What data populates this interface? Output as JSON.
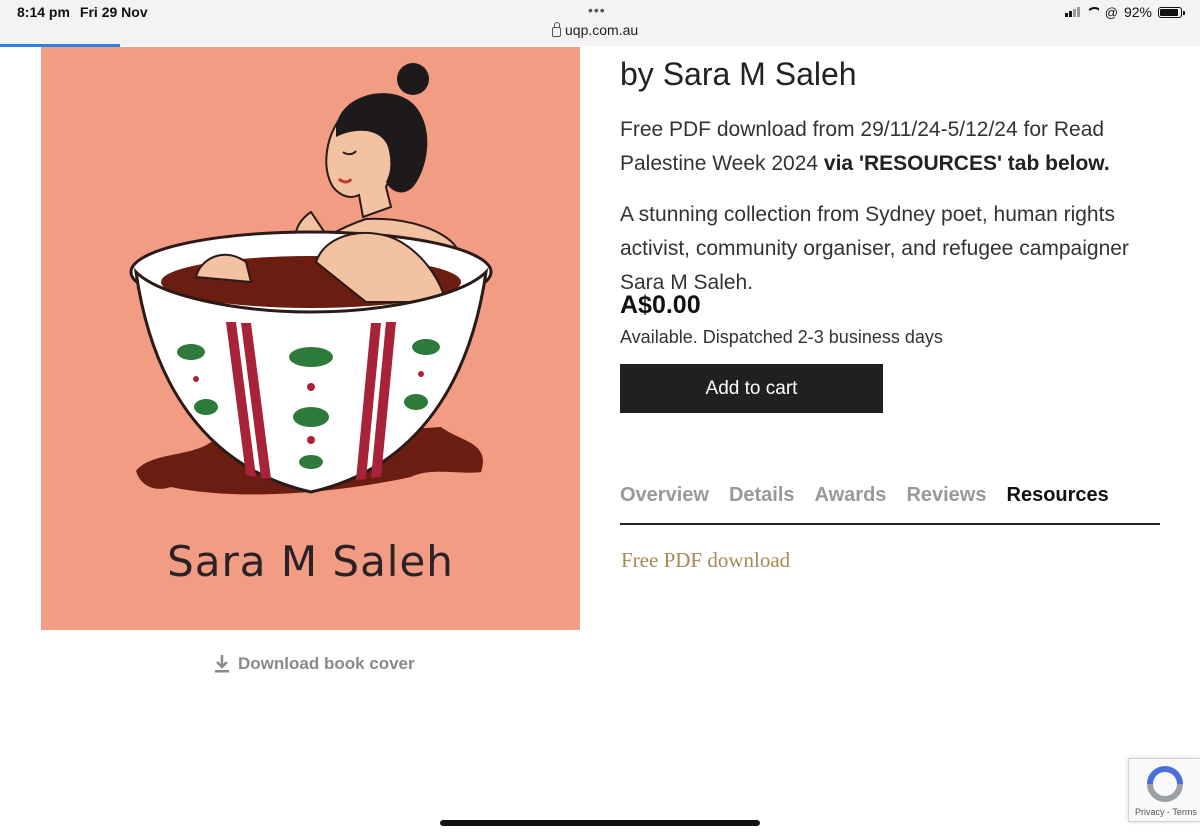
{
  "status_bar": {
    "time": "8:14 pm",
    "date": "Fri 29 Nov",
    "url": "uqp.com.au",
    "battery": "92%",
    "battery_level": 0.92,
    "page_load_progress": 0.1
  },
  "cover": {
    "author_text": "Sara M Saleh",
    "colors": {
      "background": "#f29c83",
      "hair": "#1e1a1c",
      "tea": "#6a1d10",
      "pattern_red": "#a8223a",
      "pattern_green": "#2e7a3a"
    }
  },
  "download_cover": {
    "label": "Download book cover",
    "icon": "download-icon"
  },
  "book": {
    "byline": "by Sara M Saleh",
    "promo_text": "Free PDF download from 29/11/24-5/12/24 for Read Palestine Week 2024",
    "promo_bold": "via 'RESOURCES' tab below.",
    "description": "A stunning collection from Sydney poet, human rights activist, community organiser, and refugee campaigner Sara M Saleh.",
    "price": "A$0.00",
    "availability": "Available. Dispatched 2-3 business days",
    "add_to_cart": "Add to cart"
  },
  "tabs": [
    {
      "label": "Overview",
      "active": false
    },
    {
      "label": "Details",
      "active": false
    },
    {
      "label": "Awards",
      "active": false
    },
    {
      "label": "Reviews",
      "active": false
    },
    {
      "label": "Resources",
      "active": true
    }
  ],
  "resources": {
    "link_label": "Free PDF download"
  },
  "recaptcha": {
    "links": "Privacy - Terms",
    "icon": "recaptcha-icon"
  },
  "colors": {
    "button_bg": "#221f20",
    "link_gold": "#a68a55",
    "tab_inactive": "#999999",
    "progress_blue": "#2f7fe0"
  }
}
